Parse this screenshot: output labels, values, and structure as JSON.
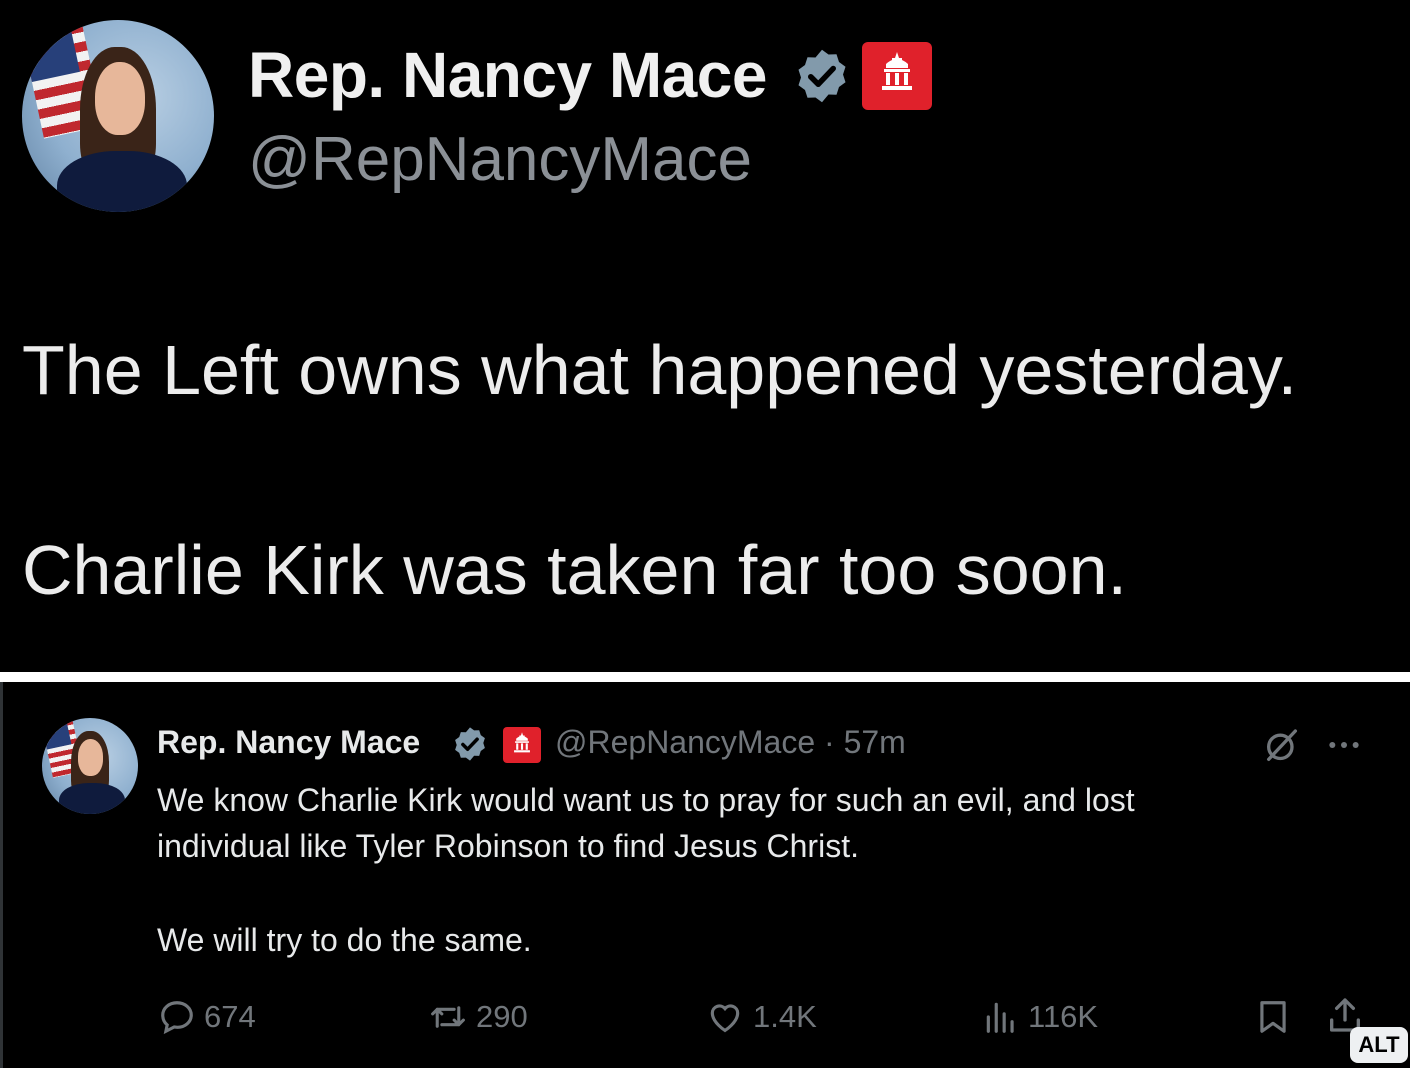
{
  "large_post": {
    "author_name": "Rep. Nancy Mace",
    "handle": "@RepNancyMace",
    "lines": [
      "The Left owns what happened yesterday.",
      "Charlie Kirk was taken far too soon."
    ]
  },
  "small_post": {
    "author_name": "Rep. Nancy Mace",
    "handle_time": "@RepNancyMace · 57m",
    "lines": [
      "We know Charlie Kirk would want us to pray for such an evil, and lost",
      "individual like Tyler Robinson to find Jesus Christ.",
      "We will try to do the same."
    ],
    "stats": {
      "replies": "674",
      "reposts": "290",
      "likes": "1.4K",
      "views": "116K"
    }
  },
  "alt_badge": "ALT",
  "icons": [
    "verified-icon",
    "gop-capitol-icon",
    "grok-icon",
    "more-icon",
    "reply-icon",
    "repost-icon",
    "like-icon",
    "views-icon",
    "bookmark-icon",
    "share-icon"
  ],
  "colors": {
    "verified": "#829aab",
    "gop_badge": "#e0212b",
    "muted_text": "#71767b"
  }
}
